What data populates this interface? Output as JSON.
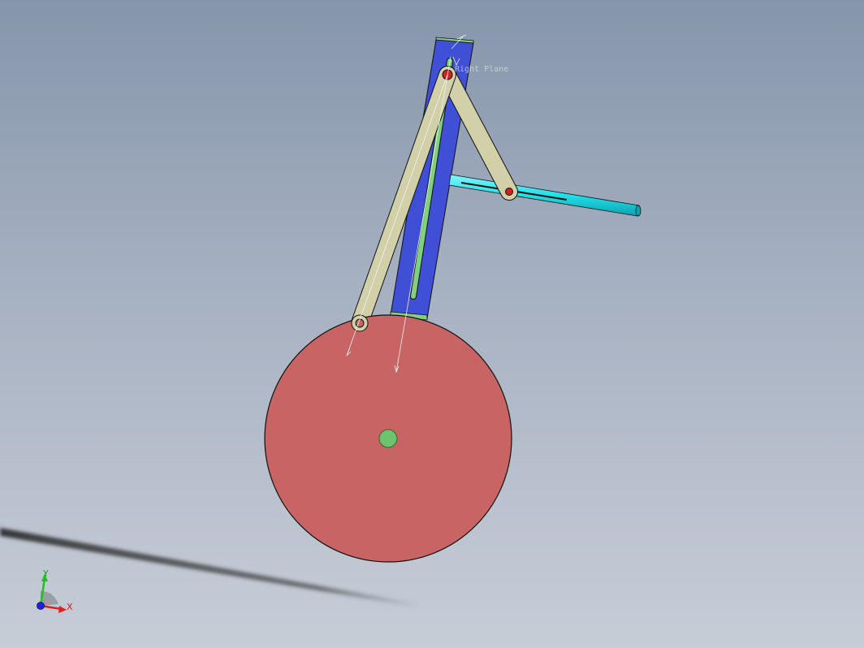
{
  "viewport": {
    "plane_label": "Right Plane",
    "colors": {
      "background_top": "#8595ab",
      "background_bottom": "#c7cdd7",
      "wheel": "#c86464",
      "hub": "#6cc46c",
      "column": "#3f4fd6",
      "slot": "#7fd07f",
      "link": "#d2d0a8",
      "rod": "#20e0e8",
      "pin": "#d02020"
    }
  },
  "triad": {
    "y_label": "Y",
    "x_label": "X",
    "y_color": "#20c020",
    "x_color": "#e02020",
    "z_color": "#2020e0"
  }
}
